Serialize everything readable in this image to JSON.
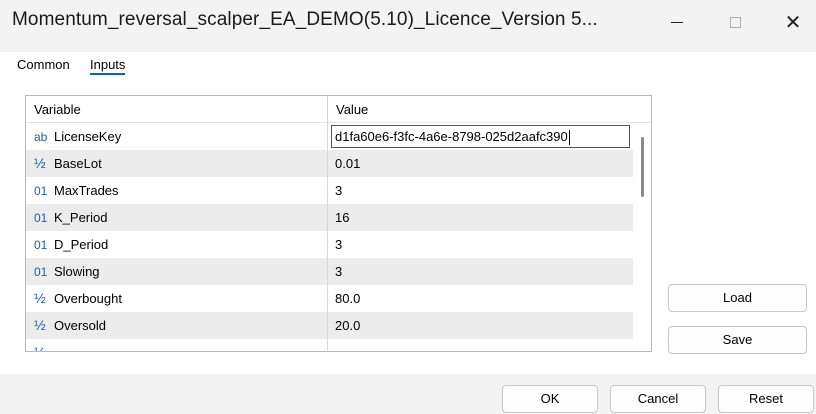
{
  "window": {
    "title": "Momentum_reversal_scalper_EA_DEMO(5.10)_Licence_Version 5...",
    "minimize_glyph": "",
    "maximize_glyph": "",
    "close_glyph": "✕"
  },
  "tabs": [
    {
      "label": "Common",
      "active": false
    },
    {
      "label": "Inputs",
      "active": true
    }
  ],
  "grid": {
    "columns": {
      "variable": "Variable",
      "value": "Value"
    },
    "rows": [
      {
        "icon": "ab",
        "icon_name": "string-type-icon",
        "name": "LicenseKey",
        "value": "d1fa60e6-f3fc-4a6e-8798-025d2aafc390",
        "editing": true
      },
      {
        "icon": "½",
        "icon_name": "double-type-icon",
        "name": "BaseLot",
        "value": "0.01"
      },
      {
        "icon": "01",
        "icon_name": "integer-type-icon",
        "name": "MaxTrades",
        "value": "3"
      },
      {
        "icon": "01",
        "icon_name": "integer-type-icon",
        "name": "K_Period",
        "value": "16"
      },
      {
        "icon": "01",
        "icon_name": "integer-type-icon",
        "name": "D_Period",
        "value": "3"
      },
      {
        "icon": "01",
        "icon_name": "integer-type-icon",
        "name": "Slowing",
        "value": "3"
      },
      {
        "icon": "½",
        "icon_name": "double-type-icon",
        "name": "Overbought",
        "value": "80.0"
      },
      {
        "icon": "½",
        "icon_name": "double-type-icon",
        "name": "Oversold",
        "value": "20.0"
      },
      {
        "icon": "½",
        "icon_name": "double-type-icon",
        "name": "",
        "value": ""
      }
    ]
  },
  "side_buttons": {
    "load": "Load",
    "save": "Save"
  },
  "footer_buttons": {
    "ok": "OK",
    "cancel": "Cancel",
    "reset": "Reset"
  },
  "colors": {
    "accent": "#0067c0",
    "icon": "#1f5fa8",
    "row_alt": "#ececec"
  }
}
